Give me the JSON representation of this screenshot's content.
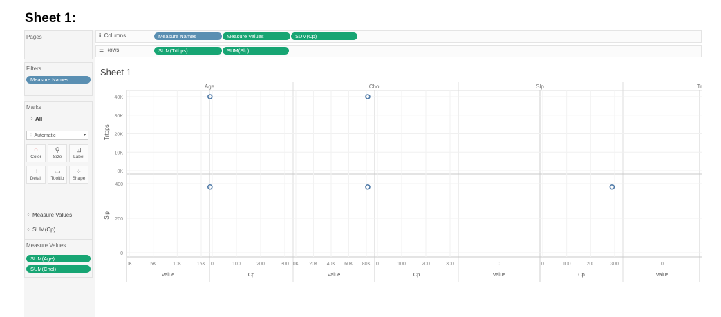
{
  "heading": "Sheet 1:",
  "panes": {
    "pages_title": "Pages",
    "filters_title": "Filters",
    "filters": [
      "Measure Names"
    ],
    "marks_title": "Marks",
    "marks_all": "All",
    "mark_type": "Automatic",
    "mark_buttons": [
      "Color",
      "Size",
      "Label",
      "Detail",
      "Tooltip",
      "Shape"
    ],
    "mark_fields": [
      "Measure Values",
      "SUM(Cp)"
    ],
    "measure_values_title": "Measure Values",
    "measure_values": [
      "SUM(Age)",
      "SUM(Chol)"
    ]
  },
  "shelves": {
    "columns_label": "Columns",
    "columns": [
      "Measure Names",
      "Measure Values",
      "SUM(Cp)"
    ],
    "rows_label": "Rows",
    "rows": [
      "SUM(Trtbps)",
      "SUM(Slp)"
    ]
  },
  "sheet_title": "Sheet 1",
  "colors": {
    "pill_blue": "#5a8fb2",
    "pill_green": "#17a573",
    "mark": "#4e79a7"
  },
  "chart_data": {
    "type": "scatter",
    "column_headers": [
      "Age",
      "Chol",
      "Slp",
      "Tr"
    ],
    "rows": [
      {
        "label": "Trtbps",
        "ticks": [
          "40K",
          "30K",
          "20K",
          "10K",
          "0K"
        ],
        "ylim": [
          0,
          40000
        ]
      },
      {
        "label": "Slp",
        "ticks": [
          "400",
          "200",
          "0"
        ],
        "ylim": [
          0,
          420
        ]
      }
    ],
    "x_panes": [
      {
        "ticks": [
          "0K",
          "5K",
          "10K",
          "15K"
        ],
        "label": "Value"
      },
      {
        "ticks": [
          "0",
          "100",
          "200",
          "300"
        ],
        "label": "Cp"
      },
      {
        "ticks": [
          "0K",
          "20K",
          "40K",
          "60K",
          "80K"
        ],
        "label": "Value"
      },
      {
        "ticks": [
          "0",
          "100",
          "200",
          "300"
        ],
        "label": "Cp"
      },
      {
        "ticks": [
          "0"
        ],
        "label": "Value"
      },
      {
        "ticks": [
          "0",
          "100",
          "200",
          "300"
        ],
        "label": "Cp"
      },
      {
        "ticks": [
          "0"
        ],
        "label": "Value"
      }
    ],
    "points": [
      {
        "pane": 0,
        "row": 0,
        "x": 16500,
        "y": 40000
      },
      {
        "pane": 2,
        "row": 0,
        "x": 80000,
        "y": 40000
      },
      {
        "pane": 0,
        "row": 1,
        "x": 16500,
        "y": 400
      },
      {
        "pane": 2,
        "row": 1,
        "x": 80000,
        "y": 400
      },
      {
        "pane": 5,
        "row": 1,
        "x": 290,
        "y": 400
      }
    ]
  }
}
